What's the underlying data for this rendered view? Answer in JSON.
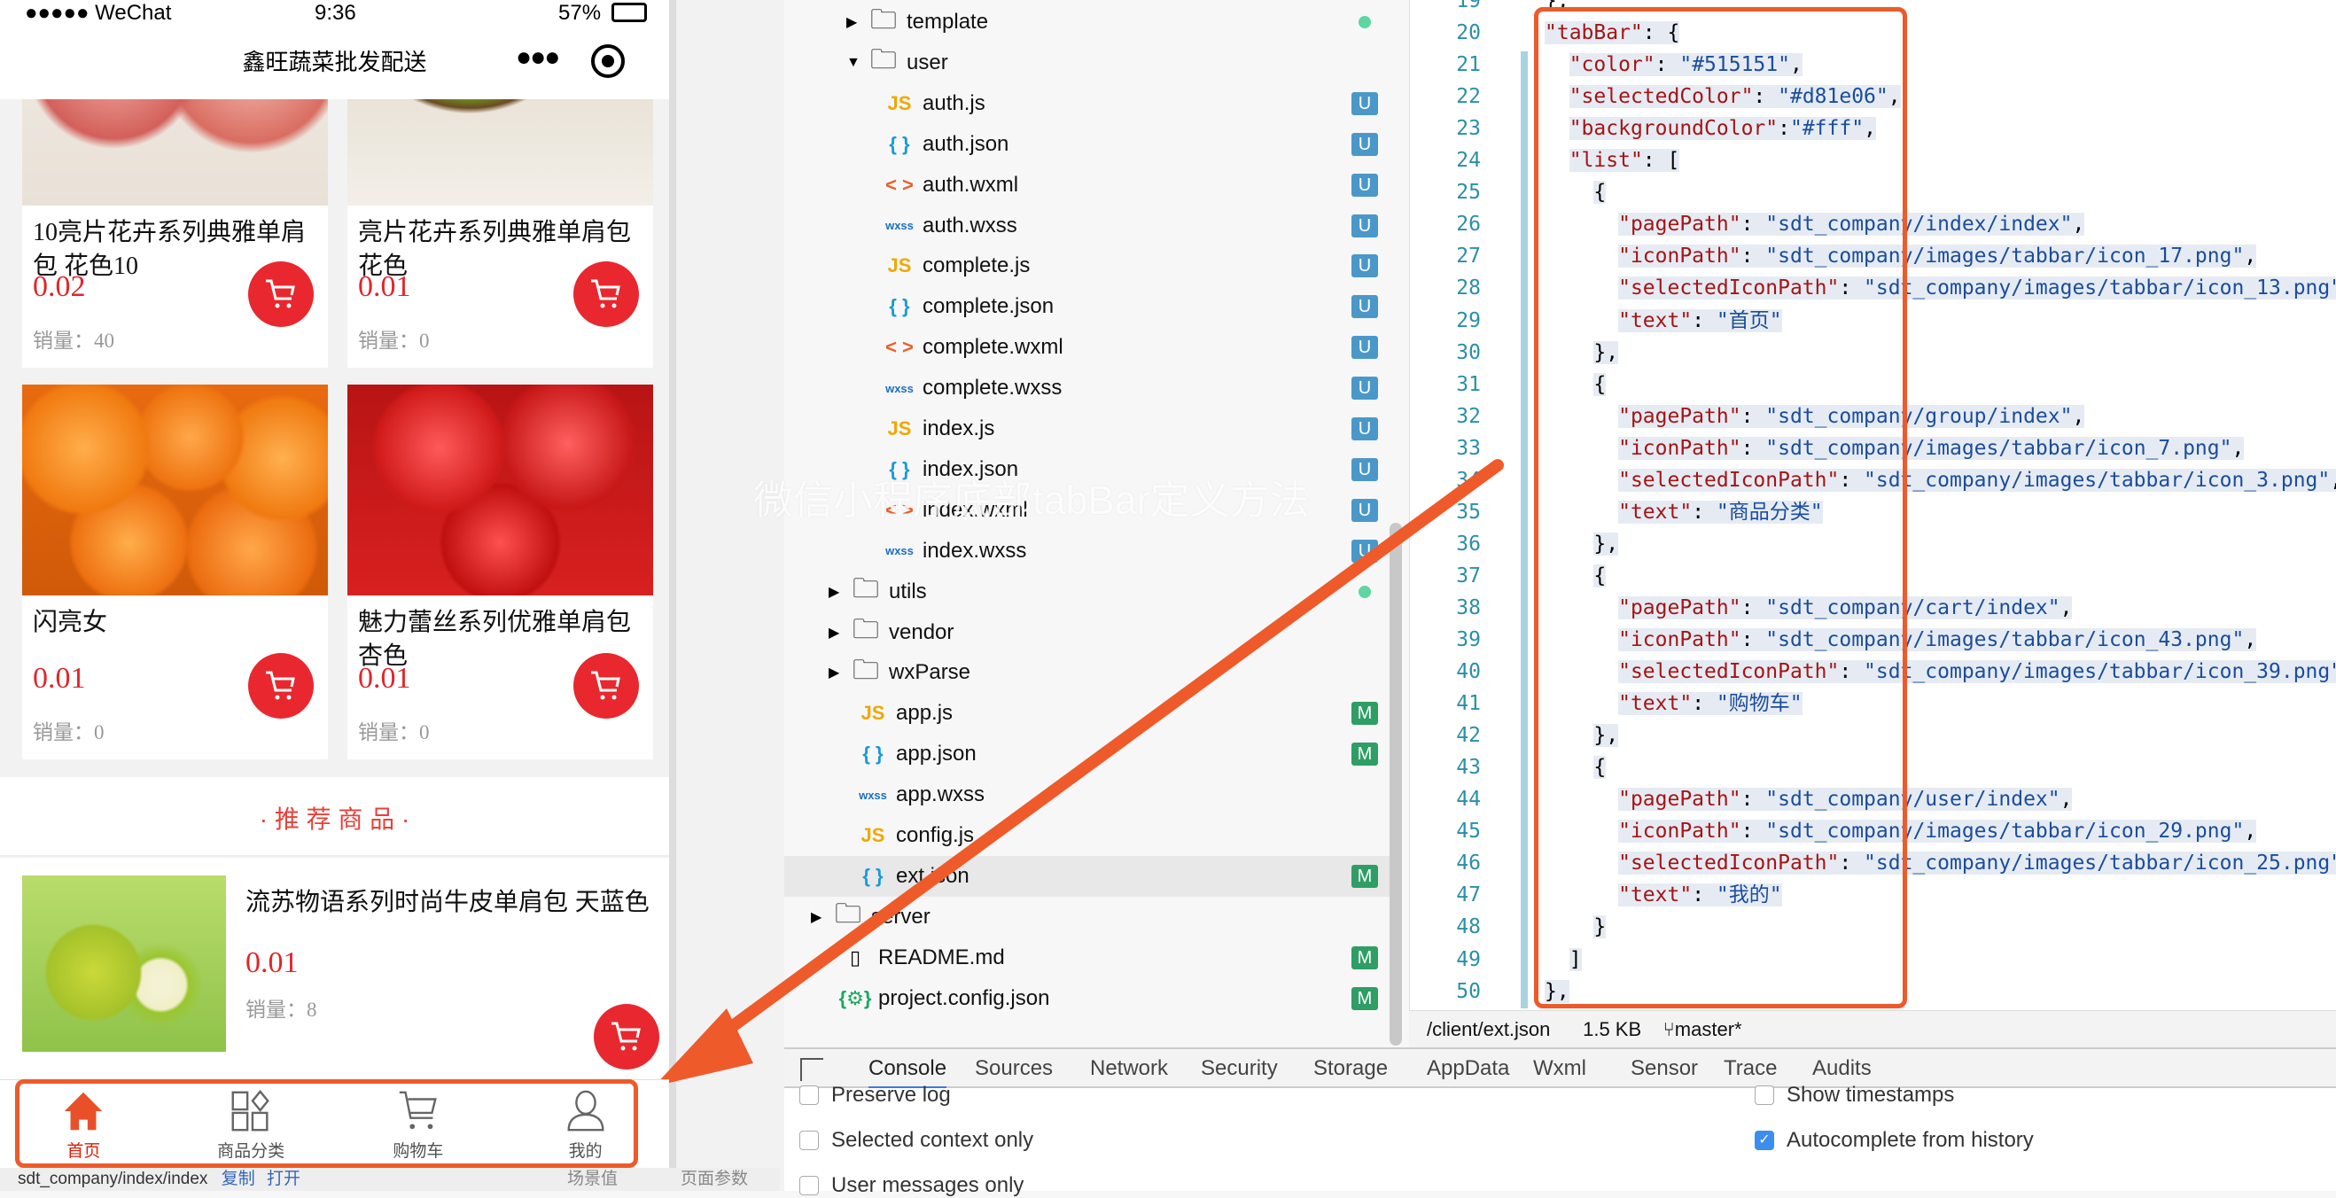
{
  "colors": {
    "accent": "#e0262b",
    "arrow": "#ee5a2a",
    "tabSelected": "#d81e06",
    "tabColor": "#515151",
    "badgeU": "#4a98c9",
    "badgeM": "#2e9e64"
  },
  "phone": {
    "status": {
      "carrier": "●●●●● WeChat",
      "time": "9:36",
      "battery": "57%"
    },
    "nav": {
      "title": "鑫旺蔬菜批发配送",
      "more_icon": "more-dots-icon",
      "target_icon": "capsule-target-icon"
    },
    "grid": [
      {
        "title": "10亮片花卉系列典雅单肩包 花色10",
        "price": "0.02",
        "sales": "销量：40",
        "image": "apples"
      },
      {
        "title": "亮片花卉系列典雅单肩包花色",
        "price": "0.01",
        "sales": "销量：0",
        "image": "kiwi"
      },
      {
        "title": "闪亮女",
        "price": "0.01",
        "sales": "销量：0",
        "image": "oranges"
      },
      {
        "title": "魅力蕾丝系列优雅单肩包杏色",
        "price": "0.01",
        "sales": "销量：0",
        "image": "strawberries"
      }
    ],
    "section_title": "· 推 荐 商 品 ·",
    "recommend": {
      "title": "流苏物语系列时尚牛皮单肩包 天蓝色",
      "price": "0.01",
      "sales": "销量：8",
      "image": "pears"
    },
    "tabbar": [
      {
        "label": "首页",
        "icon": "home-icon",
        "selected": true
      },
      {
        "label": "商品分类",
        "icon": "category-icon",
        "selected": false
      },
      {
        "label": "购物车",
        "icon": "cart-icon",
        "selected": false
      },
      {
        "label": "我的",
        "icon": "user-icon",
        "selected": false
      }
    ],
    "bottom": {
      "path": "sdt_company/index/index",
      "copy": "复制",
      "open": "打开",
      "scene": "场景值",
      "params": "页面参数"
    }
  },
  "tree": [
    {
      "name": "template",
      "type": "folder",
      "depth": 2,
      "open": false,
      "badge": "dot"
    },
    {
      "name": "user",
      "type": "folder",
      "depth": 2,
      "open": true
    },
    {
      "name": "auth.js",
      "type": "js",
      "depth": 3,
      "badge": "U"
    },
    {
      "name": "auth.json",
      "type": "json",
      "depth": 3,
      "badge": "U"
    },
    {
      "name": "auth.wxml",
      "type": "wxml",
      "depth": 3,
      "badge": "U"
    },
    {
      "name": "auth.wxss",
      "type": "wxss",
      "depth": 3,
      "badge": "U"
    },
    {
      "name": "complete.js",
      "type": "js",
      "depth": 3,
      "badge": "U"
    },
    {
      "name": "complete.json",
      "type": "json",
      "depth": 3,
      "badge": "U"
    },
    {
      "name": "complete.wxml",
      "type": "wxml",
      "depth": 3,
      "badge": "U"
    },
    {
      "name": "complete.wxss",
      "type": "wxss",
      "depth": 3,
      "badge": "U"
    },
    {
      "name": "index.js",
      "type": "js",
      "depth": 3,
      "badge": "U"
    },
    {
      "name": "index.json",
      "type": "json",
      "depth": 3,
      "badge": "U"
    },
    {
      "name": "index.wxml",
      "type": "wxml",
      "depth": 3,
      "badge": "U"
    },
    {
      "name": "index.wxss",
      "type": "wxss",
      "depth": 3,
      "badge": "U"
    },
    {
      "name": "utils",
      "type": "folder",
      "depth": 1,
      "open": false,
      "badge": "dot"
    },
    {
      "name": "vendor",
      "type": "folder",
      "depth": 1,
      "open": false
    },
    {
      "name": "wxParse",
      "type": "folder",
      "depth": 1,
      "open": false
    },
    {
      "name": "app.js",
      "type": "js",
      "depth": 2,
      "badge": "M"
    },
    {
      "name": "app.json",
      "type": "json",
      "depth": 2,
      "badge": "M"
    },
    {
      "name": "app.wxss",
      "type": "wxss",
      "depth": 2
    },
    {
      "name": "config.js",
      "type": "js",
      "depth": 2
    },
    {
      "name": "ext.json",
      "type": "json",
      "depth": 2,
      "badge": "M",
      "selected": true
    },
    {
      "name": "server",
      "type": "folder",
      "depth": 0,
      "open": false
    },
    {
      "name": "README.md",
      "type": "file",
      "depth": 1,
      "badge": "M"
    },
    {
      "name": "project.config.json",
      "type": "config",
      "depth": 1,
      "badge": "M"
    }
  ],
  "editor": {
    "first_line": 19,
    "lines": [
      "},",
      "\"tabBar\": {",
      "  \"color\": \"#515151\",",
      "  \"selectedColor\": \"#d81e06\",",
      "  \"backgroundColor\":\"#fff\",",
      "  \"list\": [",
      "    {",
      "      \"pagePath\": \"sdt_company/index/index\",",
      "      \"iconPath\": \"sdt_company/images/tabbar/icon_17.png\",",
      "      \"selectedIconPath\": \"sdt_company/images/tabbar/icon_13.png\",",
      "      \"text\": \"首页\"",
      "    },",
      "    {",
      "      \"pagePath\": \"sdt_company/group/index\",",
      "      \"iconPath\": \"sdt_company/images/tabbar/icon_7.png\",",
      "      \"selectedIconPath\": \"sdt_company/images/tabbar/icon_3.png\",",
      "      \"text\": \"商品分类\"",
      "    },",
      "    {",
      "      \"pagePath\": \"sdt_company/cart/index\",",
      "      \"iconPath\": \"sdt_company/images/tabbar/icon_43.png\",",
      "      \"selectedIconPath\": \"sdt_company/images/tabbar/icon_39.png\",",
      "      \"text\": \"购物车\"",
      "    },",
      "    {",
      "      \"pagePath\": \"sdt_company/user/index\",",
      "      \"iconPath\": \"sdt_company/images/tabbar/icon_29.png\",",
      "      \"selectedIconPath\": \"sdt_company/images/tabbar/icon_25.png\",",
      "      \"text\": \"我的\"",
      "    }",
      "  ]",
      "},"
    ],
    "status": {
      "path": "/client/ext.json",
      "size": "1.5 KB",
      "branch": "master*"
    }
  },
  "devtools": {
    "tabs": [
      "Console",
      "Sources",
      "Network",
      "Security",
      "Storage",
      "AppData",
      "Wxml",
      "Sensor",
      "Trace",
      "Audits"
    ],
    "active": "Console",
    "options_left": [
      {
        "label": "Preserve log",
        "checked": false
      },
      {
        "label": "Selected context only",
        "checked": false
      },
      {
        "label": "User messages only",
        "checked": false
      }
    ],
    "options_right": [
      {
        "label": "Show timestamps",
        "checked": false
      },
      {
        "label": "Autocomplete from history",
        "checked": true
      }
    ]
  },
  "watermark": "微信小程序底部tabBar定义方法"
}
